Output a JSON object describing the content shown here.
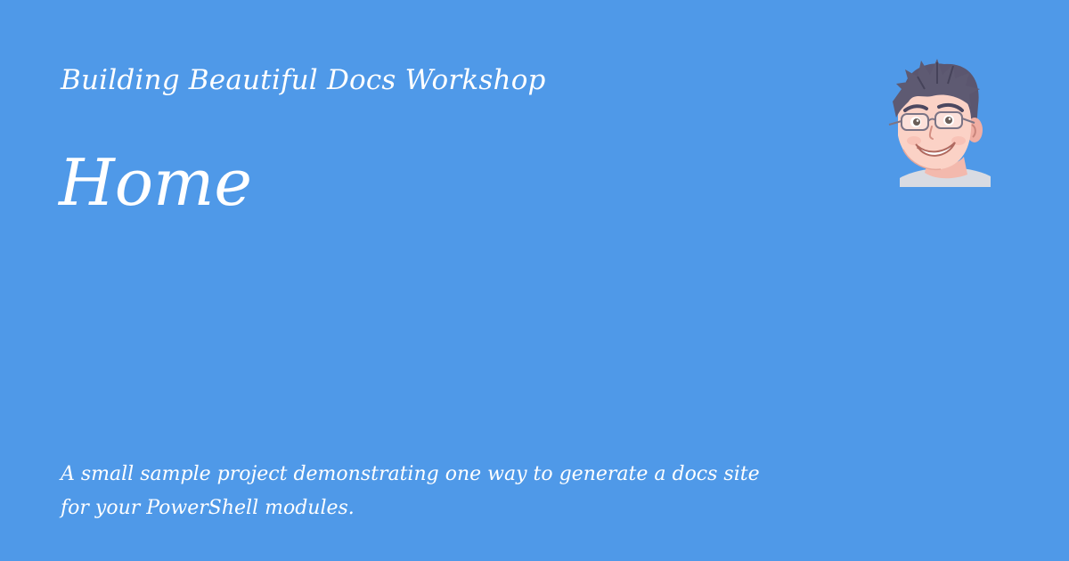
{
  "colors": {
    "background": "#4f99e8",
    "text": "#ffffff"
  },
  "card": {
    "site_name": "Building Beautiful Docs Workshop",
    "page_title": "Home",
    "description": "A small sample project demonstrating one way to generate a docs site for your PowerShell modules."
  },
  "avatar": {
    "icon": "cartoon-avatar-man-with-glasses"
  }
}
